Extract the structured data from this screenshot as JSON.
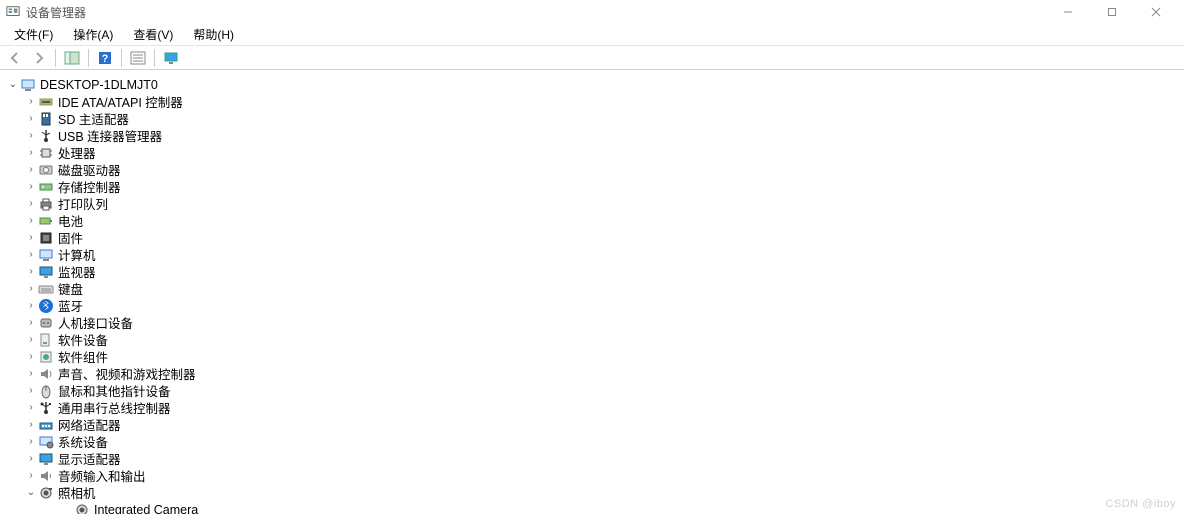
{
  "window": {
    "title": "设备管理器"
  },
  "menu": {
    "file": "文件(F)",
    "action": "操作(A)",
    "view": "查看(V)",
    "help": "帮助(H)"
  },
  "toolbar": {
    "back": "后退",
    "forward": "前进",
    "show_hide": "显示/隐藏控制台树",
    "help": "帮助",
    "properties": "属性",
    "monitor": "监视器"
  },
  "root": {
    "name": "DESKTOP-1DLMJT0"
  },
  "categories": [
    {
      "label": "IDE ATA/ATAPI 控制器",
      "icon": "ide"
    },
    {
      "label": "SD 主适配器",
      "icon": "sd"
    },
    {
      "label": "USB 连接器管理器",
      "icon": "usb"
    },
    {
      "label": "处理器",
      "icon": "cpu"
    },
    {
      "label": "磁盘驱动器",
      "icon": "disk"
    },
    {
      "label": "存储控制器",
      "icon": "storage"
    },
    {
      "label": "打印队列",
      "icon": "printer"
    },
    {
      "label": "电池",
      "icon": "battery"
    },
    {
      "label": "固件",
      "icon": "firmware"
    },
    {
      "label": "计算机",
      "icon": "computer"
    },
    {
      "label": "监视器",
      "icon": "monitor"
    },
    {
      "label": "键盘",
      "icon": "keyboard"
    },
    {
      "label": "蓝牙",
      "icon": "bluetooth"
    },
    {
      "label": "人机接口设备",
      "icon": "hid"
    },
    {
      "label": "软件设备",
      "icon": "software"
    },
    {
      "label": "软件组件",
      "icon": "component"
    },
    {
      "label": "声音、视频和游戏控制器",
      "icon": "audio"
    },
    {
      "label": "鼠标和其他指针设备",
      "icon": "mouse"
    },
    {
      "label": "通用串行总线控制器",
      "icon": "usbctrl"
    },
    {
      "label": "网络适配器",
      "icon": "network"
    },
    {
      "label": "系统设备",
      "icon": "system"
    },
    {
      "label": "显示适配器",
      "icon": "display"
    },
    {
      "label": "音频输入和输出",
      "icon": "audioio"
    }
  ],
  "camera": {
    "label": "照相机",
    "child": "Integrated Camera"
  },
  "watermark": "CSDN @iboy"
}
